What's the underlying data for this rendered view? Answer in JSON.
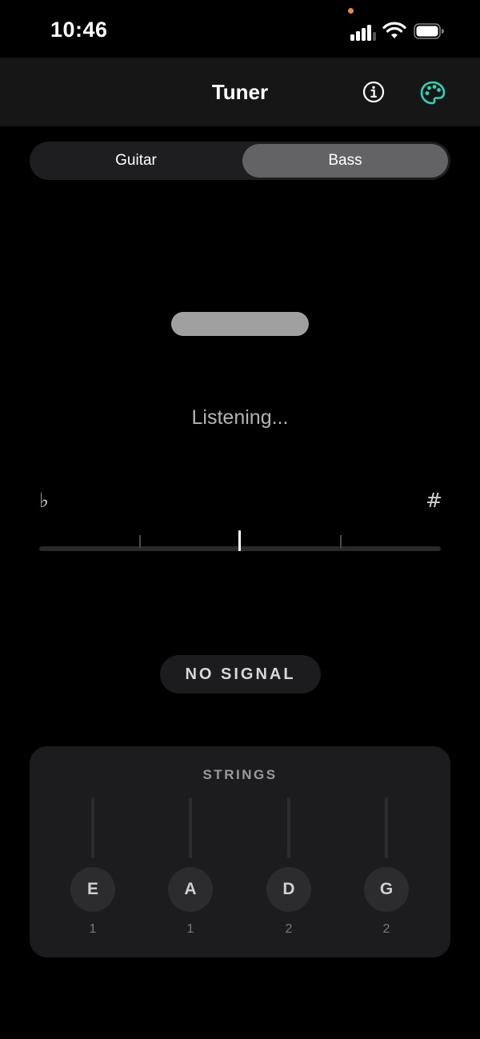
{
  "status_bar": {
    "time": "10:46"
  },
  "header": {
    "title": "Tuner"
  },
  "instrument_selector": {
    "options": [
      "Guitar",
      "Bass"
    ],
    "selected": "Bass"
  },
  "tuner": {
    "status_text": "Listening...",
    "flat_symbol": "♭",
    "sharp_symbol": "#",
    "signal_label": "NO SIGNAL"
  },
  "strings": {
    "title": "STRINGS",
    "items": [
      {
        "note": "E",
        "octave": "1"
      },
      {
        "note": "A",
        "octave": "1"
      },
      {
        "note": "D",
        "octave": "2"
      },
      {
        "note": "G",
        "octave": "2"
      }
    ]
  },
  "colors": {
    "background": "#000000",
    "accent": "#2ed3b7",
    "selected_segment": "#636366",
    "privacy_indicator": "#f08a3a"
  },
  "icons": [
    "signal-icon",
    "wifi-icon",
    "battery-icon",
    "info-icon",
    "palette-icon"
  ]
}
